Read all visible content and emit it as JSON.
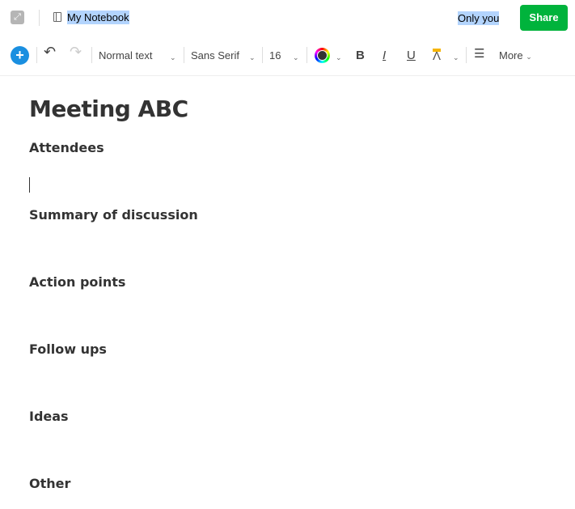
{
  "header": {
    "notebook": "My Notebook",
    "sharing": "Only you",
    "share_label": "Share"
  },
  "toolbar": {
    "style": "Normal text",
    "font": "Sans Serif",
    "size": "16",
    "more": "More",
    "bold": "B",
    "italic": "I",
    "underline": "U",
    "accent": "#1a8fe0",
    "share_color": "#00b33c"
  },
  "note": {
    "title": "Meeting ABC",
    "sections": [
      "Attendees",
      "Summary of discussion",
      "Action points",
      "Follow ups",
      "Ideas",
      "Other"
    ]
  }
}
